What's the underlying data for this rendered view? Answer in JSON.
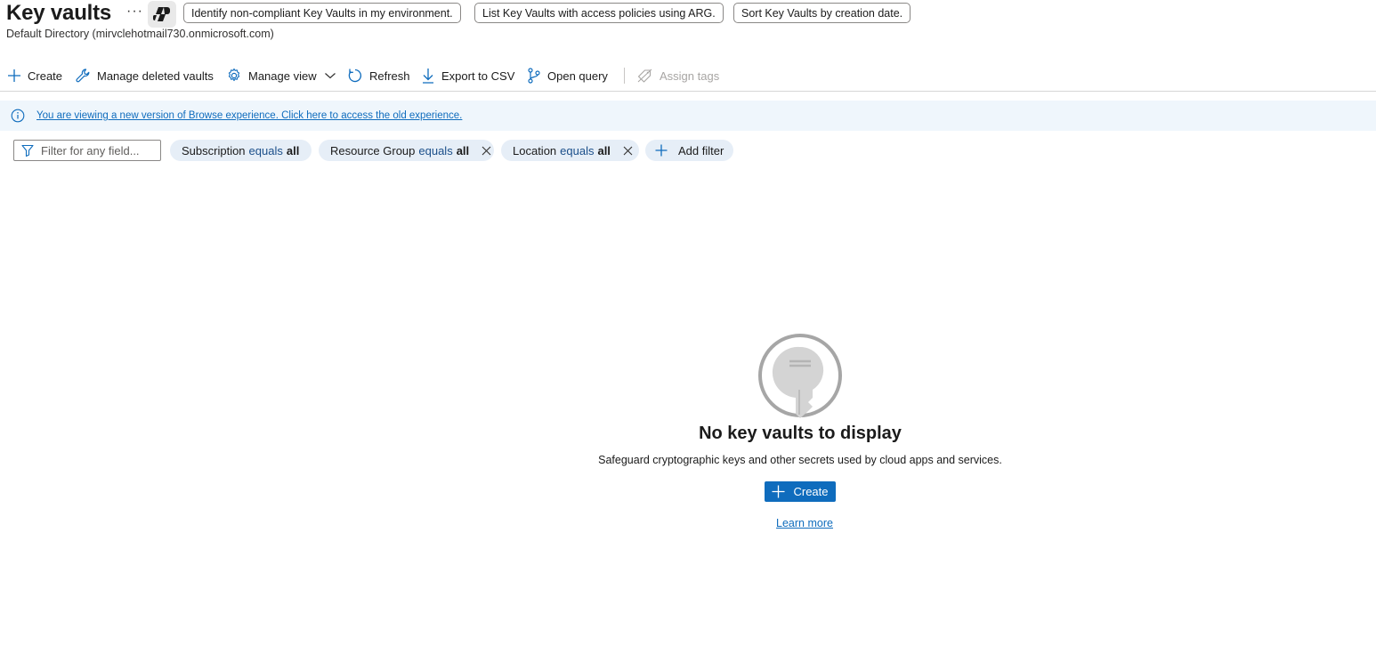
{
  "header": {
    "title": "Key vaults",
    "subtitle": "Default Directory (mirvclehotmail730.onmicrosoft.com)",
    "more_label": "···",
    "copilot_icon": "copilot-icon",
    "suggestions": [
      "Identify non-compliant Key Vaults in my environment.",
      "List Key Vaults with access policies using ARG.",
      "Sort Key Vaults by creation date."
    ]
  },
  "toolbar": {
    "create": "Create",
    "manage_deleted": "Manage deleted vaults",
    "manage_view": "Manage view",
    "refresh": "Refresh",
    "export_csv": "Export to CSV",
    "open_query": "Open query",
    "assign_tags": "Assign tags"
  },
  "banner": {
    "text": "You are viewing a new version of Browse experience. Click here to access the old experience."
  },
  "filters": {
    "search_placeholder": "Filter for any field...",
    "pills": [
      {
        "field": "Subscription",
        "op": "equals",
        "value": "all"
      },
      {
        "field": "Resource Group",
        "op": "equals",
        "value": "all"
      },
      {
        "field": "Location",
        "op": "equals",
        "value": "all"
      }
    ],
    "add_filter": "Add filter"
  },
  "empty_state": {
    "icon": "key-icon",
    "title": "No key vaults to display",
    "description": "Safeguard cryptographic keys and other secrets used by cloud apps and services.",
    "create_label": "Create",
    "learn_more": "Learn more"
  },
  "colors": {
    "accent": "#0f6cbd",
    "banner_bg": "#eff6fc",
    "pill_bg": "#e6eef7"
  }
}
